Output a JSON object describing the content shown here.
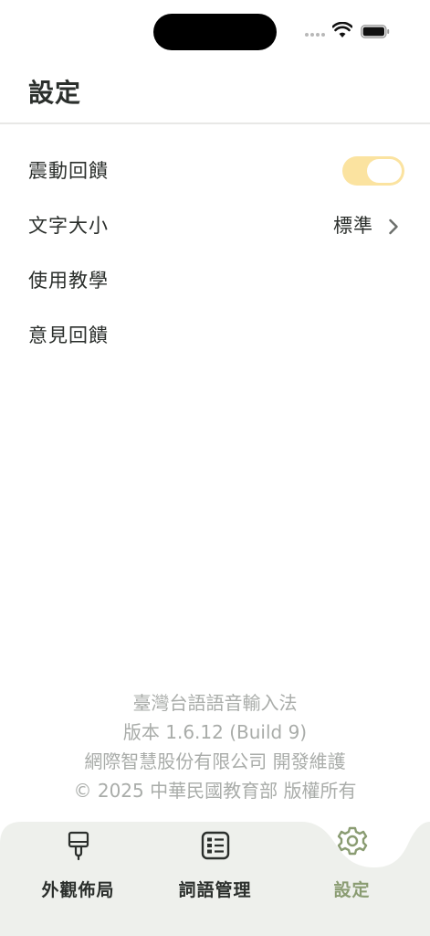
{
  "header": {
    "title": "設定"
  },
  "settings": {
    "haptic": {
      "label": "震動回饋",
      "enabled": true
    },
    "font_size": {
      "label": "文字大小",
      "value": "標準"
    },
    "tutorial": {
      "label": "使用教學"
    },
    "feedback": {
      "label": "意見回饋"
    }
  },
  "footer": {
    "app_name": "臺灣台語語音輸入法",
    "version": "版本 1.6.12 (Build 9)",
    "developer": "網際智慧股份有限公司 開發維護",
    "copyright": "© 2025 中華民國教育部 版權所有"
  },
  "tabs": [
    {
      "label": "外觀佈局",
      "icon": "brush-icon",
      "active": false
    },
    {
      "label": "詞語管理",
      "icon": "list-icon",
      "active": false
    },
    {
      "label": "設定",
      "icon": "gear-icon",
      "active": true
    }
  ],
  "colors": {
    "accent": "#8a9c72",
    "toggle_on": "#fbe3a0",
    "tab_bar_bg": "#eef0ec",
    "muted_text": "#a9aca9"
  }
}
